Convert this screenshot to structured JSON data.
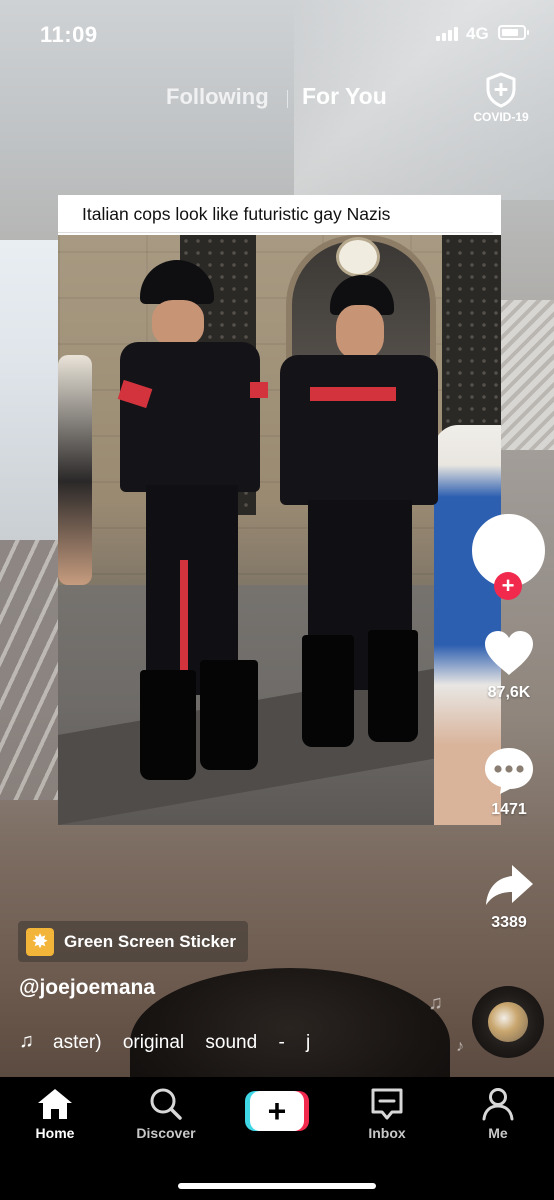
{
  "status_bar": {
    "time": "11:09",
    "network": "4G",
    "battery_level": 0.8
  },
  "feed_tabs": {
    "following": "Following",
    "for_you": "For You",
    "active": "For You"
  },
  "covid": {
    "label": "COVID-19"
  },
  "post": {
    "caption": "Italian cops look like futuristic gay Nazis",
    "username": "@joejoemana",
    "sticker": {
      "label": "Green Screen Sticker",
      "icon": "sparkle-icon"
    },
    "sound": {
      "partial": "aster)",
      "title": "original sound - jtr"
    }
  },
  "actions": {
    "likes": "87,6K",
    "comments": "1471",
    "shares": "3389"
  },
  "nav": {
    "home": "Home",
    "discover": "Discover",
    "inbox": "Inbox",
    "me": "Me",
    "active": "Home"
  },
  "colors": {
    "accent_red": "#f0294d",
    "accent_cyan": "#3fd6e6",
    "nav_bg": "#000000"
  }
}
